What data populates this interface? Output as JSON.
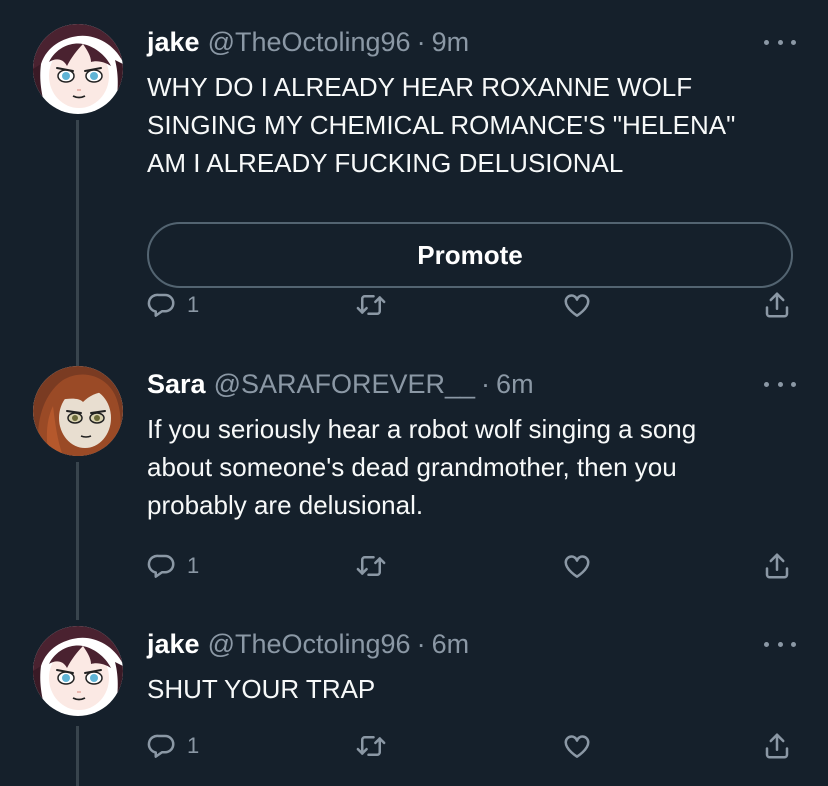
{
  "tweets": [
    {
      "name": "jake",
      "handle": "@TheOctoling96",
      "separator": "·",
      "time": "9m",
      "lines": [
        "WHY DO I ALREADY HEAR ROXANNE WOLF",
        "SINGING MY CHEMICAL ROMANCE'S \"HELENA\"",
        "AM I ALREADY FUCKING DELUSIONAL"
      ],
      "promote_label": "Promote",
      "reply_count": "1",
      "avatar_icon": "anime-avatar-dark-hair"
    },
    {
      "name": "Sara",
      "handle": "@SARAFOREVER__",
      "separator": "·",
      "time": "6m",
      "lines": [
        "If you seriously hear a robot wolf singing a song",
        "about someone's dead grandmother, then you",
        "probably are delusional."
      ],
      "reply_count": "1",
      "avatar_icon": "anime-avatar-auburn-hair"
    },
    {
      "name": "jake",
      "handle": "@TheOctoling96",
      "separator": "·",
      "time": "6m",
      "lines": [
        "SHUT YOUR TRAP"
      ],
      "reply_count": "1",
      "avatar_icon": "anime-avatar-dark-hair"
    }
  ],
  "icons": {
    "reply": "reply-icon",
    "retweet": "retweet-icon",
    "like": "heart-icon",
    "share": "share-icon",
    "more": "more-options-icon"
  },
  "colors": {
    "background": "#15202b",
    "secondary_text": "#8b98a5",
    "thread_line": "#38444d"
  }
}
